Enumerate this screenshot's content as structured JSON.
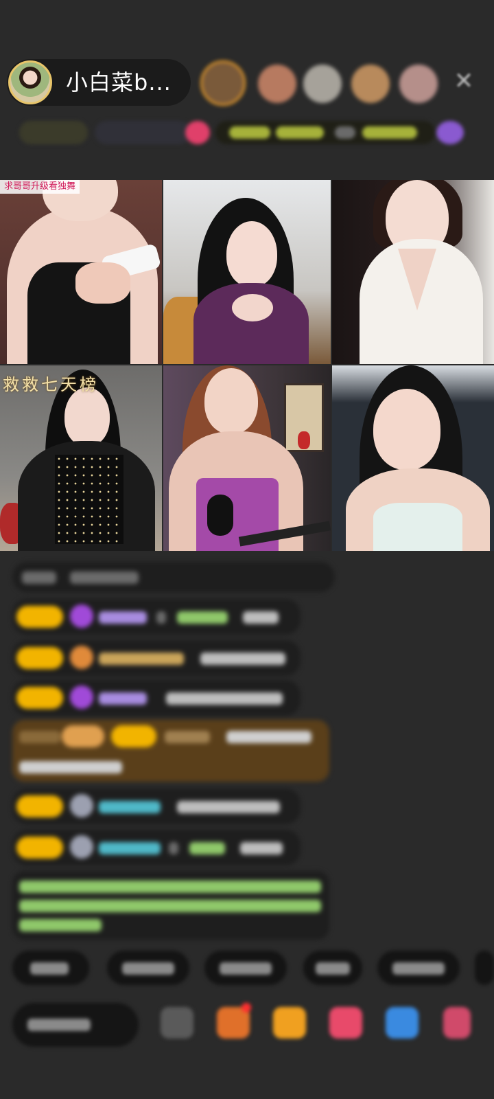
{
  "host": {
    "name": "小白菜b..."
  },
  "viewers": [
    {
      "color": "#c9822c"
    },
    {
      "color": "#b77a60"
    },
    {
      "color": "#a6a29a"
    },
    {
      "color": "#b88a5c"
    },
    {
      "color": "#b58f8a"
    }
  ],
  "close_glyph": "✕",
  "grid": {
    "tiles": [
      {
        "banner": "求哥哥升级看独舞",
        "caption": ""
      },
      {
        "banner": "",
        "caption": ""
      },
      {
        "banner": "",
        "caption": ""
      },
      {
        "banner": "",
        "caption": "救救七天榜"
      },
      {
        "banner": "",
        "caption": ""
      },
      {
        "banner": "",
        "caption": ""
      }
    ]
  },
  "colors": {
    "background": "#2a2a2a",
    "badge_gold": "#f2b400",
    "chat_pill": "#1e1e1e",
    "highlight_msg": "#5a3f1a",
    "system_text_green": "#8fc86a",
    "username_purple": "#a88ce0",
    "username_teal": "#4fb8c8"
  }
}
